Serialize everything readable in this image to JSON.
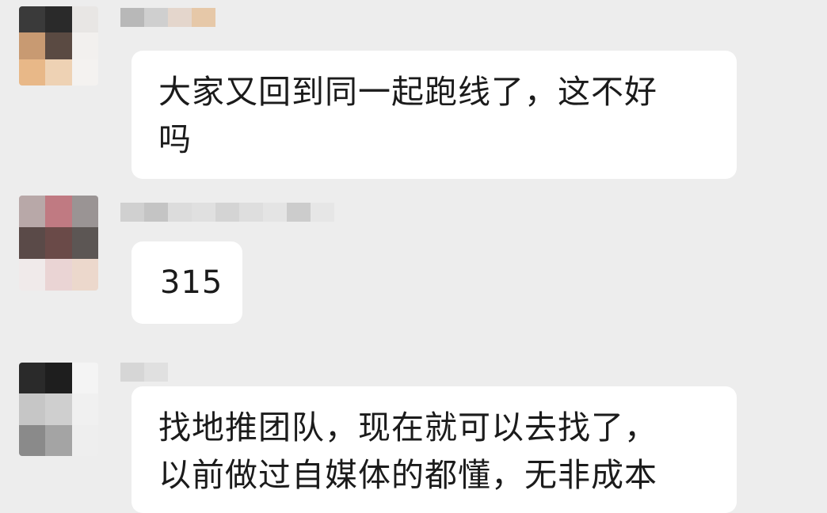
{
  "messages": [
    {
      "text": "大家又回到同一起跑线了，这不好\n吗"
    },
    {
      "text": "315"
    },
    {
      "text": "找地推团队，现在就可以去找了，\n以前做过自媒体的都懂，无非成本"
    }
  ],
  "colors": {
    "background": "#ededed",
    "bubble": "#ffffff",
    "text": "#1b1b1b"
  }
}
